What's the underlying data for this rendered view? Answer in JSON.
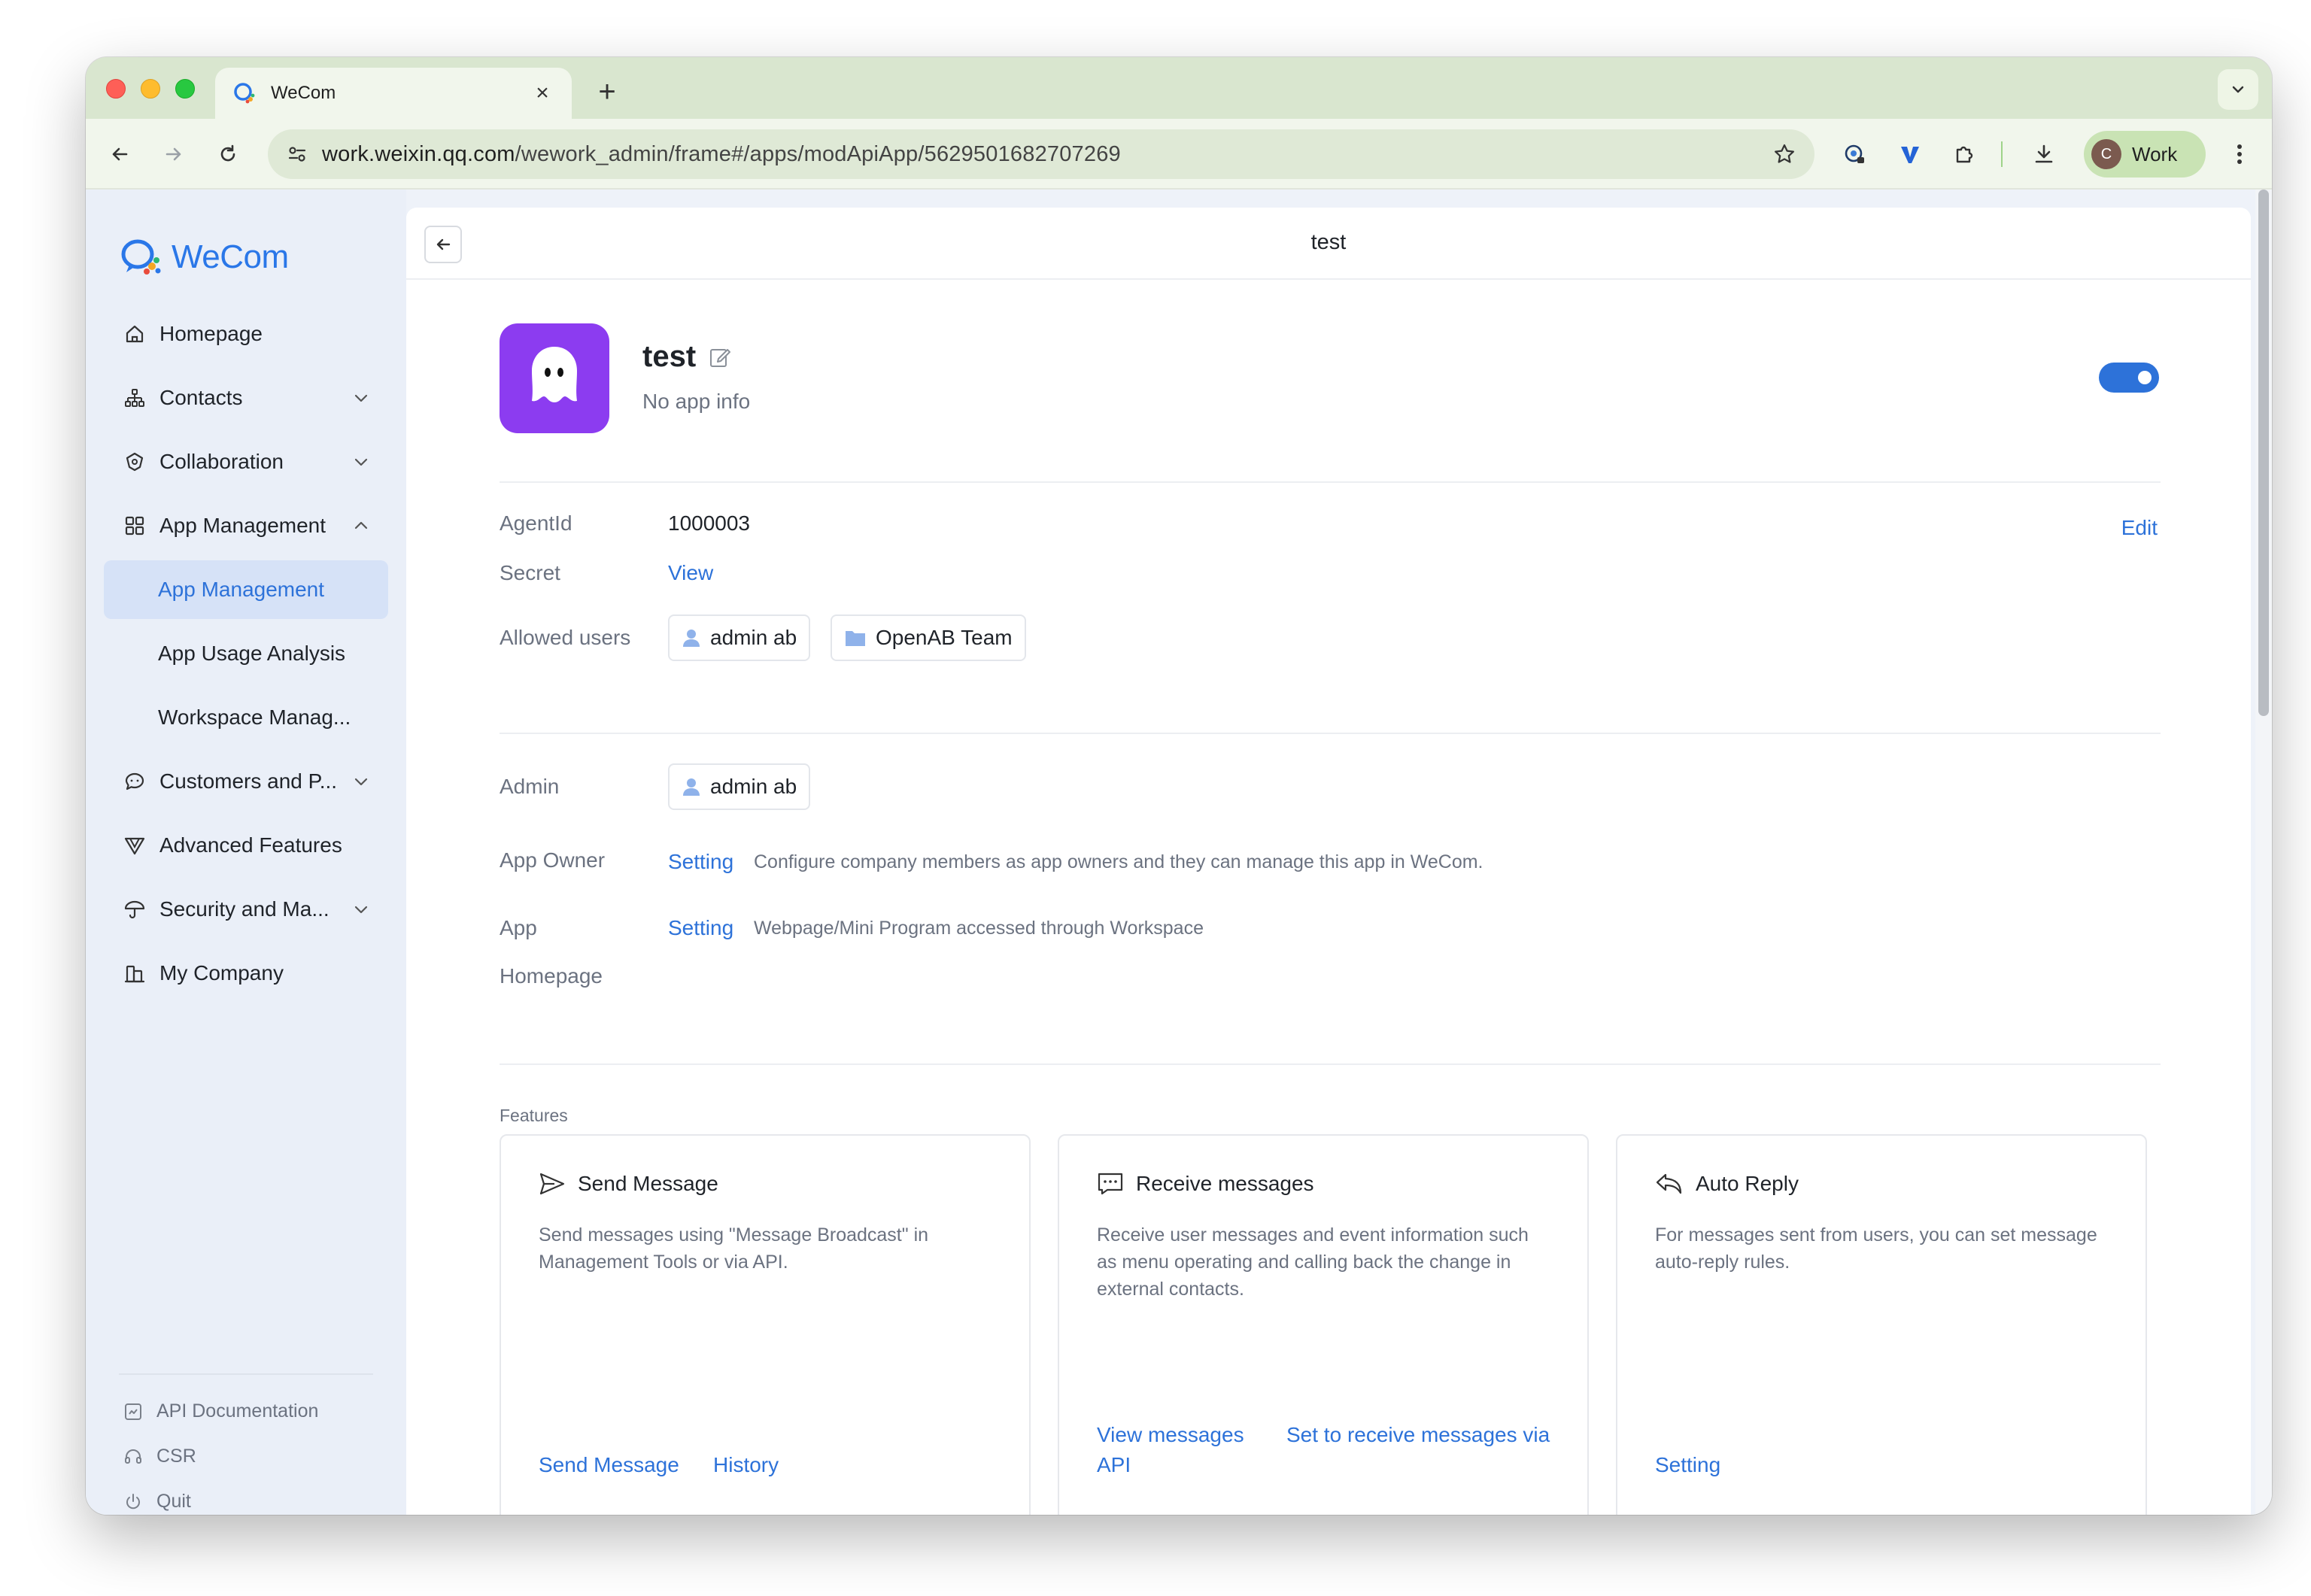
{
  "browser": {
    "tab_title": "WeCom",
    "tab_close": "×",
    "new_tab": "+",
    "url_host": "work.weixin.qq.com",
    "url_path": "/wework_admin/frame#/apps/modApiApp/5629501682707269",
    "profile_initial": "C",
    "profile_label": "Work"
  },
  "sidebar": {
    "logo_text": "WeCom",
    "items": [
      {
        "label": "Homepage",
        "icon": "home-icon"
      },
      {
        "label": "Contacts",
        "icon": "org-chart-icon",
        "expand": "chevron-down-icon"
      },
      {
        "label": "Collaboration",
        "icon": "collaboration-icon",
        "expand": "chevron-down-icon"
      },
      {
        "label": "App Management",
        "icon": "apps-grid-icon",
        "expand": "chevron-up-icon"
      },
      {
        "label": "App Management",
        "active": true
      },
      {
        "label": "App Usage Analysis"
      },
      {
        "label": "Workspace Manag..."
      },
      {
        "label": "Customers and P...",
        "icon": "chat-bubble-icon",
        "expand": "chevron-down-icon"
      },
      {
        "label": "Advanced Features",
        "icon": "advanced-icon"
      },
      {
        "label": "Security and Ma...",
        "icon": "umbrella-icon",
        "expand": "chevron-down-icon"
      },
      {
        "label": "My Company",
        "icon": "building-icon"
      }
    ],
    "footer": [
      {
        "label": "API Documentation",
        "icon": "api-doc-icon"
      },
      {
        "label": "CSR",
        "icon": "headset-icon"
      },
      {
        "label": "Quit",
        "icon": "power-icon"
      }
    ]
  },
  "panel": {
    "title": "test",
    "app_name": "test",
    "app_desc": "No app info",
    "toggle_on": true,
    "accent": "#2d72d9",
    "app_icon_color": "#8c3cf0",
    "agentid_label": "AgentId",
    "agentid_value": "1000003",
    "edit_label": "Edit",
    "secret_label": "Secret",
    "secret_value": "View",
    "allowed_label": "Allowed users",
    "allowed": [
      {
        "label": "admin ab",
        "icon": "user-icon"
      },
      {
        "label": "OpenAB Team",
        "icon": "folder-icon"
      }
    ],
    "admin_label": "Admin",
    "admin_chip": "admin ab",
    "owner_label": "App Owner",
    "owner_action": "Setting",
    "owner_hint": "Configure company members as app owners and they can manage this app in WeCom.",
    "homepage_label_1": "App",
    "homepage_label_2": "Homepage",
    "homepage_action": "Setting",
    "homepage_hint": "Webpage/Mini Program accessed through Workspace",
    "features_label": "Features"
  },
  "cards": [
    {
      "title": "Send Message",
      "desc": "Send messages using \"Message Broadcast\" in Management Tools or via API.",
      "actions": [
        "Send Message",
        "History"
      ]
    },
    {
      "title": "Receive messages",
      "desc": "Receive user messages and event information such as menu operating and calling back the change in external contacts.",
      "actions": [
        "View messages",
        "Set to receive messages via",
        "API"
      ]
    },
    {
      "title": "Auto Reply",
      "desc": "For messages sent from users, you can set message auto-reply rules.",
      "actions": [
        "Setting"
      ]
    }
  ]
}
